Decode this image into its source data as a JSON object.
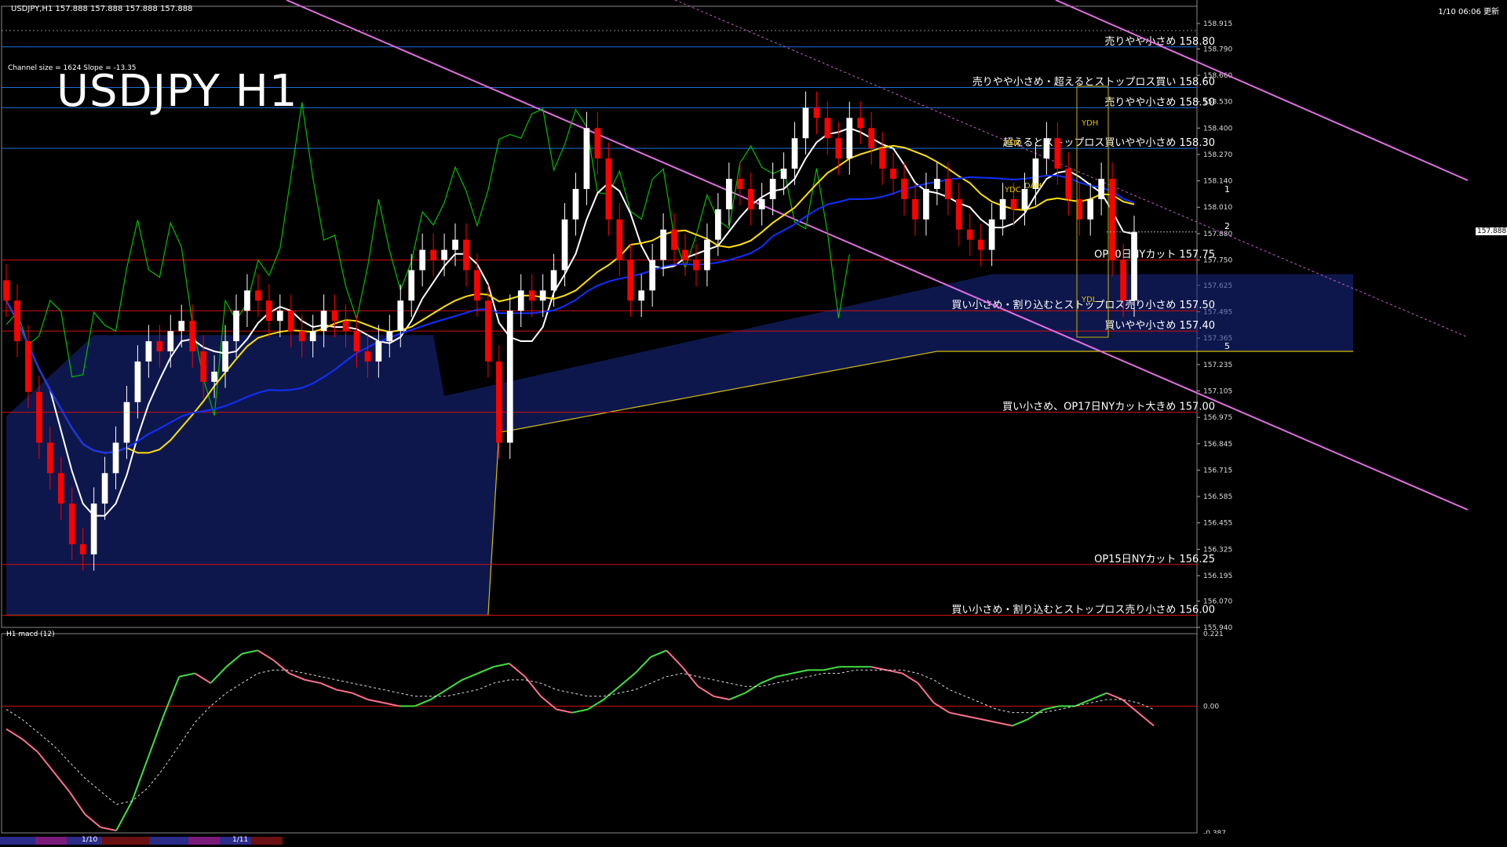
{
  "header": {
    "symbol_info": "USDJPY,H1  157.888 157.888 157.888 157.888",
    "updated": "1/10 06:06 更新",
    "channel_info": "Channel size = 1624 Slope = -13.35",
    "big_title": "USDJPY H1",
    "indicator_title": "H1  macd (12)"
  },
  "colors": {
    "bg": "#000000",
    "grid_blue": "#1e6fd9",
    "red_line": "#d01010",
    "magenta": "#e070e0",
    "bull": "#ffffff",
    "bear": "#ff0000",
    "ma_fast": "#ffffff",
    "ma_mid": "#ffe000",
    "ma_slow": "#1030ff",
    "cloud": "#1a2a8a",
    "chikou": "#00c000",
    "macd_up": "#40e040",
    "macd_down": "#ff7090"
  },
  "levels": [
    {
      "price": 158.8,
      "label": "売りやや小さめ 158.80",
      "color": "#1e6fd9"
    },
    {
      "price": 158.6,
      "label": "売りやや小さめ・超えるとストップロス買い 158.60",
      "color": "#1e6fd9"
    },
    {
      "price": 158.5,
      "label": "売りやや小さめ 158.50",
      "color": "#1e6fd9"
    },
    {
      "price": 158.3,
      "label": "超えるとストップロス買いやや小さめ 158.30",
      "color": "#1e6fd9"
    },
    {
      "price": 157.75,
      "label": "OP10日NYカット 157.75",
      "color": "#d01010"
    },
    {
      "price": 157.5,
      "label": "買い小さめ・割り込むとストップロス売り小さめ 157.50",
      "color": "#d01010"
    },
    {
      "price": 157.4,
      "label": "買いやや小さめ 157.40",
      "color": "#d01010"
    },
    {
      "price": 157.0,
      "label": "買い小さめ、OP17日NYカット大きめ 157.00",
      "color": "#d01010"
    },
    {
      "price": 156.25,
      "label": "OP15日NYカット 156.25",
      "color": "#d01010"
    },
    {
      "price": 156.0,
      "label": "買い小さめ・割り込むとストップロス売り小さめ 156.00",
      "color": "#d01010"
    }
  ],
  "box_labels": [
    "YDH",
    "YDC",
    "YDL",
    "YDO",
    "DAH"
  ],
  "current_price": "157.888",
  "channel_marks": [
    "1",
    "2",
    "5"
  ],
  "chart_data": {
    "type": "candlestick",
    "symbol": "USDJPY",
    "timeframe": "H1",
    "ylim": [
      155.94,
      159.0
    ],
    "y_ticks": [
      "158.915",
      "158.790",
      "158.660",
      "158.530",
      "158.400",
      "158.270",
      "158.140",
      "158.010",
      "157.880",
      "157.750",
      "157.625",
      "157.495",
      "157.365",
      "157.235",
      "157.105",
      "156.975",
      "156.845",
      "156.715",
      "156.585",
      "156.455",
      "156.325",
      "156.195",
      "156.070",
      "155.940"
    ],
    "x_ticks": [
      "1/10",
      "1/11"
    ],
    "closes": [
      157.55,
      157.35,
      157.1,
      156.85,
      156.7,
      156.55,
      156.35,
      156.3,
      156.55,
      156.7,
      156.85,
      157.05,
      157.25,
      157.35,
      157.3,
      157.4,
      157.45,
      157.3,
      157.15,
      157.2,
      157.35,
      157.5,
      157.6,
      157.55,
      157.45,
      157.5,
      157.4,
      157.35,
      157.4,
      157.5,
      157.45,
      157.4,
      157.3,
      157.25,
      157.35,
      157.4,
      157.55,
      157.7,
      157.8,
      157.75,
      157.8,
      157.85,
      157.7,
      157.55,
      157.25,
      156.85,
      157.5,
      157.6,
      157.55,
      157.6,
      157.7,
      157.95,
      158.1,
      158.4,
      158.25,
      157.95,
      157.75,
      157.55,
      157.6,
      157.75,
      157.9,
      157.8,
      157.75,
      157.7,
      157.85,
      158.0,
      158.15,
      158.1,
      158.0,
      158.05,
      158.15,
      158.2,
      158.35,
      158.5,
      158.45,
      158.35,
      158.25,
      158.45,
      158.4,
      158.3,
      158.2,
      158.15,
      158.05,
      157.95,
      158.1,
      158.15,
      158.05,
      157.9,
      157.85,
      157.8,
      157.95,
      158.05,
      158.0,
      158.1,
      158.25,
      158.35,
      158.2,
      158.05,
      157.95,
      158.05,
      158.15,
      157.75,
      157.55,
      157.888
    ],
    "macd_ylim": [
      -0.387,
      0.221
    ],
    "macd_ticks": [
      "0.221",
      "0.00",
      "-0.387"
    ],
    "macd_main": [
      -0.07,
      -0.1,
      -0.14,
      -0.2,
      -0.26,
      -0.33,
      -0.37,
      -0.38,
      -0.29,
      -0.16,
      -0.03,
      0.09,
      0.1,
      0.07,
      0.12,
      0.16,
      0.17,
      0.14,
      0.1,
      0.08,
      0.07,
      0.05,
      0.04,
      0.02,
      0.01,
      0.0,
      0.0,
      0.02,
      0.05,
      0.08,
      0.1,
      0.12,
      0.13,
      0.09,
      0.03,
      -0.01,
      -0.02,
      -0.01,
      0.02,
      0.06,
      0.1,
      0.15,
      0.17,
      0.12,
      0.06,
      0.03,
      0.02,
      0.04,
      0.07,
      0.09,
      0.1,
      0.11,
      0.11,
      0.12,
      0.12,
      0.12,
      0.11,
      0.1,
      0.07,
      0.01,
      -0.02,
      -0.03,
      -0.04,
      -0.05,
      -0.06,
      -0.04,
      -0.01,
      0.0,
      0.0,
      0.02,
      0.04,
      0.02,
      -0.02,
      -0.06
    ],
    "macd_signal": [
      -0.01,
      -0.04,
      -0.08,
      -0.12,
      -0.17,
      -0.22,
      -0.26,
      -0.3,
      -0.29,
      -0.25,
      -0.19,
      -0.12,
      -0.05,
      0.0,
      0.04,
      0.07,
      0.1,
      0.11,
      0.11,
      0.1,
      0.09,
      0.08,
      0.07,
      0.06,
      0.05,
      0.04,
      0.03,
      0.03,
      0.03,
      0.04,
      0.05,
      0.07,
      0.08,
      0.08,
      0.07,
      0.05,
      0.04,
      0.03,
      0.03,
      0.04,
      0.05,
      0.07,
      0.09,
      0.1,
      0.09,
      0.08,
      0.07,
      0.06,
      0.06,
      0.07,
      0.08,
      0.09,
      0.1,
      0.1,
      0.11,
      0.11,
      0.11,
      0.11,
      0.1,
      0.08,
      0.05,
      0.03,
      0.01,
      -0.01,
      -0.02,
      -0.02,
      -0.02,
      -0.01,
      0.0,
      0.01,
      0.02,
      0.02,
      0.01,
      -0.01
    ]
  }
}
